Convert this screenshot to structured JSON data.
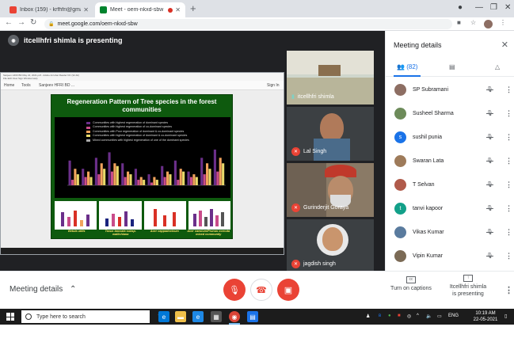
{
  "browser": {
    "tabs": [
      {
        "title": "Inbox (159) - krfhfri@gmail.com",
        "favicon": "gmail-icon",
        "active": false
      },
      {
        "title": "Meet - oem-nkxd-sbw",
        "favicon": "meet-icon",
        "active": true
      }
    ],
    "url": "meet.google.com/oem-nkxd-sbw"
  },
  "meet": {
    "presenting_banner": "itcellhfri shimla is presenting",
    "shared_slide": {
      "window_title": "Sanjeev HFRI BD May 22, 2021.pdf - Adobe Acrobat Reader DC (32-bit)",
      "menu": "File  Edit  View  Sign  Window  Help",
      "tools": [
        "Home",
        "Tools",
        "Sanjeev HFRI BD ..."
      ],
      "sign_in": "Sign In",
      "title": "Regeneration Pattern of Tree species in the forest communities",
      "legend": [
        "Communities with highest regeneration of dominant species",
        "Communities with highest regeneration of co-dominant species",
        "Communities with Poor regeneration of dominant & co-dominant species",
        "Communities with highest regeneration of dominant & co-dominant species",
        "Mixed communities with highest regeneration of one of the dominant species"
      ],
      "captions": [
        "Betula utilis",
        "Taxus baccata subsp. wallichiana",
        "Acer cappadocicum",
        "Acer caesium/Prunus cornuta mixed community"
      ]
    },
    "tiles": [
      {
        "name": "itcellhfri shimla"
      },
      {
        "name": "Lal Singh"
      },
      {
        "name": "Gurinderjit Goraya"
      },
      {
        "name": "jagdish singh"
      }
    ],
    "side_panel": {
      "title": "Meeting details",
      "people_count": "(82)",
      "participants": [
        {
          "name": "SP Subramani",
          "initial": "",
          "color": "#8d6e63"
        },
        {
          "name": "Susheel Sharma",
          "initial": "",
          "color": "#6d8b5a"
        },
        {
          "name": "sushil punia",
          "initial": "s",
          "color": "#1a73e8"
        },
        {
          "name": "Swaran Lata",
          "initial": "",
          "color": "#9e7b5a"
        },
        {
          "name": "T Selvan",
          "initial": "",
          "color": "#b05a4a"
        },
        {
          "name": "tanvi kapoor",
          "initial": "t",
          "color": "#12a089"
        },
        {
          "name": "Vikas Kumar",
          "initial": "",
          "color": "#5a7b9e"
        },
        {
          "name": "Vipin Kumar",
          "initial": "",
          "color": "#7b6a55"
        }
      ]
    },
    "controls": {
      "meeting_details": "Meeting details",
      "turn_on_captions": "Turn on captions",
      "presenting_line1": "Itcellhfri shimla",
      "presenting_line2": "is presenting"
    }
  },
  "taskbar": {
    "search_placeholder": "Type here to search",
    "lang": "ENG",
    "time": "10:19 AM",
    "date": "22-05-2021"
  },
  "chart_data": {
    "type": "bar",
    "title": "Regeneration Pattern of Tree species in the forest communities",
    "ylim": [
      0,
      15
    ],
    "series": [
      {
        "values": [
          9,
          6,
          10,
          12,
          8,
          6,
          4,
          7,
          9,
          5,
          10,
          13
        ]
      },
      {
        "values": [
          2,
          3,
          4,
          5,
          3,
          2,
          1,
          3,
          2,
          3,
          4,
          5
        ]
      },
      {
        "values": [
          6,
          5,
          8,
          8,
          5,
          3,
          3,
          5,
          6,
          4,
          8,
          10
        ]
      },
      {
        "values": [
          4,
          3,
          6,
          7,
          4,
          2,
          2,
          4,
          5,
          3,
          6,
          8
        ]
      }
    ],
    "colors": [
      "#6b2f8a",
      "#c94c8a",
      "#f2a35c",
      "#e8d96a"
    ]
  }
}
